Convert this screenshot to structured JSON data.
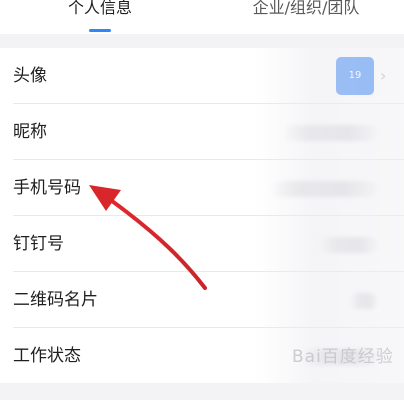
{
  "tabs": [
    {
      "label": "个人信息",
      "active": true
    },
    {
      "label": "企业/组织/团队",
      "active": false
    }
  ],
  "rows": [
    {
      "label": "头像",
      "avatar_text": "19",
      "chevron_icon": "chevron-right-icon"
    },
    {
      "label": "昵称"
    },
    {
      "label": "手机号码"
    },
    {
      "label": "钉钉号"
    },
    {
      "label": "二维码名片"
    },
    {
      "label": "工作状态"
    }
  ],
  "colors": {
    "accent": "#2f86f6",
    "avatar_bg": "#3a86f7",
    "annotation_arrow": "#d9262b"
  },
  "annotation": {
    "icon": "red-arrow-icon",
    "points_to": "手机号码"
  },
  "watermark": {
    "text": "Bai百度经验"
  }
}
